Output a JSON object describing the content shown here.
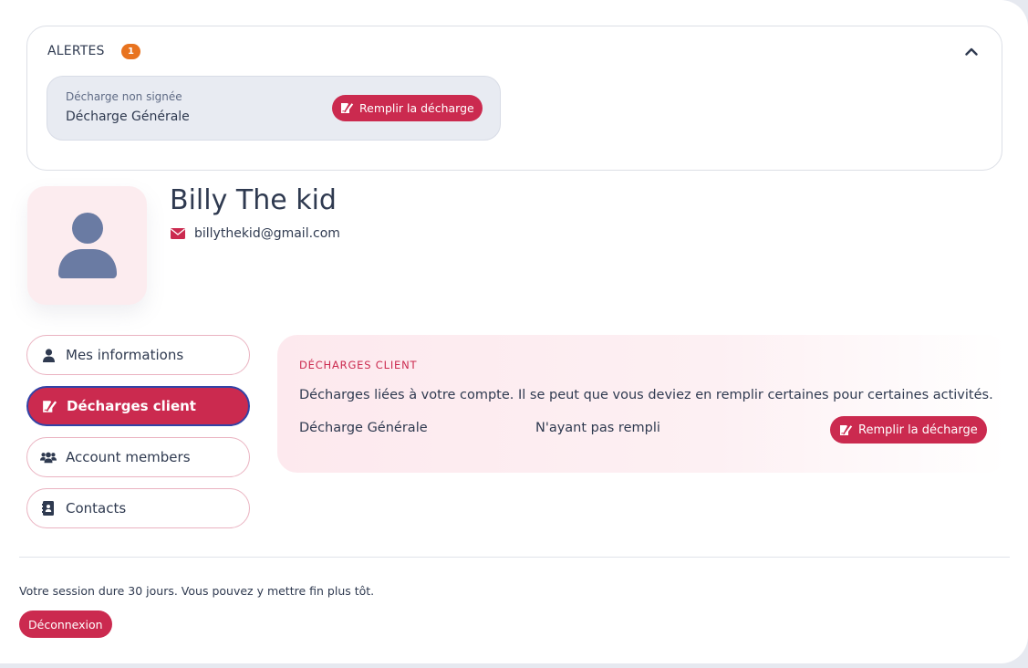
{
  "alerts": {
    "title": "ALERTES",
    "count": "1",
    "items": [
      {
        "subtitle": "Décharge non signée",
        "title": "Décharge Générale",
        "action_label": "Remplir la décharge"
      }
    ]
  },
  "profile": {
    "name": "Billy The kid",
    "email": "billythekid@gmail.com"
  },
  "nav": {
    "items": [
      {
        "label": "Mes informations",
        "icon": "user-icon",
        "active": false
      },
      {
        "label": "Décharges client",
        "icon": "signature-icon",
        "active": true
      },
      {
        "label": "Account members",
        "icon": "users-icon",
        "active": false
      },
      {
        "label": "Contacts",
        "icon": "address-book-icon",
        "active": false
      }
    ]
  },
  "panel": {
    "title": "DÉCHARGES CLIENT",
    "description": "Décharges liées à votre compte. Il se peut que vous deviez en remplir certaines pour certaines activités.",
    "rows": [
      {
        "name": "Décharge Générale",
        "status": "N'ayant pas rempli",
        "action_label": "Remplir la décharge"
      }
    ]
  },
  "footer": {
    "session_text": "Votre session dure 30 jours. Vous pouvez y mettre fin plus tôt.",
    "logout_label": "Déconnexion"
  },
  "colors": {
    "accent": "#cb2a4f",
    "badge": "#e8731f",
    "active_border": "#3243a6"
  }
}
